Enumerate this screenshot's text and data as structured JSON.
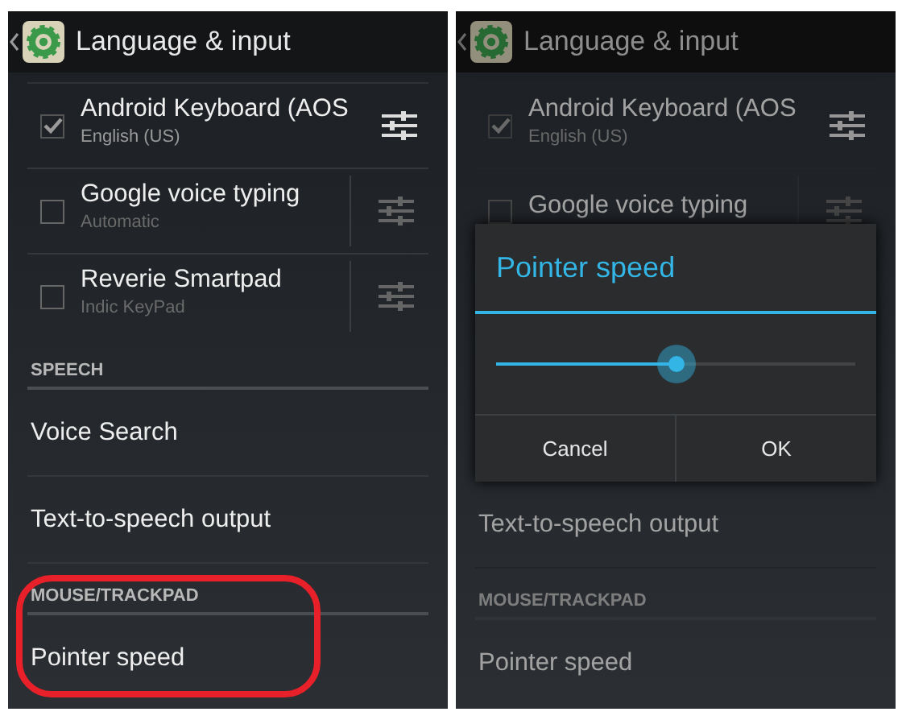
{
  "screens": [
    {
      "title": "Language & input",
      "dimmed": false,
      "items": [
        {
          "kind": "input_method",
          "label": "Android Keyboard (AOS",
          "subtitle": "English (US)",
          "checked": true
        },
        {
          "kind": "input_method",
          "label": "Google voice typing",
          "subtitle": "Automatic",
          "checked": false
        },
        {
          "kind": "input_method",
          "label": "Reverie Smartpad",
          "subtitle": "Indic KeyPad",
          "checked": false
        },
        {
          "kind": "header",
          "label": "SPEECH"
        },
        {
          "kind": "entry",
          "label": "Voice Search"
        },
        {
          "kind": "entry",
          "label": "Text-to-speech output"
        },
        {
          "kind": "header",
          "label": "MOUSE/TRACKPAD",
          "highlighted": true
        },
        {
          "kind": "entry",
          "label": "Pointer speed",
          "highlighted": true
        }
      ]
    },
    {
      "title": "Language & input",
      "dimmed": true,
      "items": [
        {
          "kind": "input_method",
          "label": "Android Keyboard (AOS",
          "subtitle": "English (US)",
          "checked": true
        },
        {
          "kind": "input_method",
          "label": "Google voice typing",
          "checked": false
        },
        {
          "kind": "dialog",
          "title": "Pointer speed",
          "level": 0.5,
          "buttons": [
            "Cancel",
            "OK"
          ]
        },
        {
          "kind": "entry",
          "label": "Text-to-speech output"
        },
        {
          "kind": "header",
          "label": "MOUSE/TRACKPAD"
        },
        {
          "kind": "entry",
          "label": "Pointer speed"
        }
      ]
    }
  ]
}
